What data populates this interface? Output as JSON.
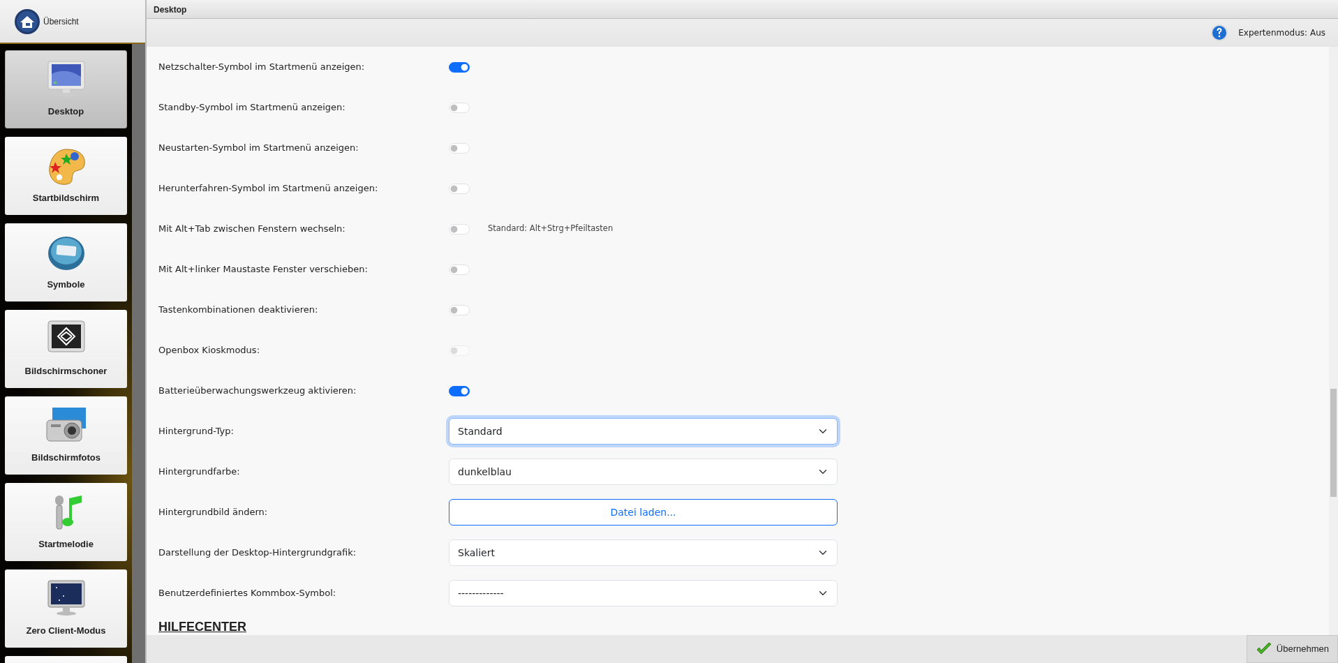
{
  "home": {
    "label": "Übersicht"
  },
  "sidebar": {
    "items": [
      {
        "label": "Desktop",
        "selected": true
      },
      {
        "label": "Startbildschirm",
        "selected": false
      },
      {
        "label": "Symbole",
        "selected": false
      },
      {
        "label": "Bildschirmschoner",
        "selected": false
      },
      {
        "label": "Bildschirmfotos",
        "selected": false
      },
      {
        "label": "Startmelodie",
        "selected": false
      },
      {
        "label": "Zero Client-Modus",
        "selected": false
      }
    ]
  },
  "window": {
    "title": "Desktop"
  },
  "toolbar": {
    "expert_mode": "Expertenmodus: Aus"
  },
  "settings": [
    {
      "kind": "toggle",
      "label": "Netzschalter-Symbol im Startmenü anzeigen:",
      "on": true,
      "disabled": false
    },
    {
      "kind": "toggle",
      "label": "Standby-Symbol im Startmenü anzeigen:",
      "on": false,
      "disabled": false
    },
    {
      "kind": "toggle",
      "label": "Neustarten-Symbol im Startmenü anzeigen:",
      "on": false,
      "disabled": false
    },
    {
      "kind": "toggle",
      "label": "Herunterfahren-Symbol im Startmenü anzeigen:",
      "on": false,
      "disabled": false
    },
    {
      "kind": "toggle",
      "label": "Mit Alt+Tab zwischen Fenstern wechseln:",
      "on": false,
      "disabled": false,
      "hint": "Standard: Alt+Strg+Pfeiltasten"
    },
    {
      "kind": "toggle",
      "label": "Mit Alt+linker Maustaste Fenster verschieben:",
      "on": false,
      "disabled": false
    },
    {
      "kind": "toggle",
      "label": "Tastenkombinationen deaktivieren:",
      "on": false,
      "disabled": false
    },
    {
      "kind": "toggle",
      "label": "Openbox Kioskmodus:",
      "on": false,
      "disabled": true
    },
    {
      "kind": "toggle",
      "label": "Batterieüberwachungswerkzeug aktivieren:",
      "on": true,
      "disabled": false
    },
    {
      "kind": "select",
      "label": "Hintergrund-Typ:",
      "value": "Standard",
      "focused": true
    },
    {
      "kind": "select",
      "label": "Hintergrundfarbe:",
      "value": "dunkelblau",
      "focused": false
    },
    {
      "kind": "file",
      "label": "Hintergrundbild ändern:",
      "button": "Datei laden..."
    },
    {
      "kind": "select",
      "label": "Darstellung der Desktop-Hintergrundgrafik:",
      "value": "Skaliert",
      "focused": false
    },
    {
      "kind": "select",
      "label": "Benutzerdefiniertes Kommbox-Symbol:",
      "value": "-------------",
      "focused": false
    }
  ],
  "section_heading": "HILFECENTER",
  "apply_button": "Übernehmen"
}
